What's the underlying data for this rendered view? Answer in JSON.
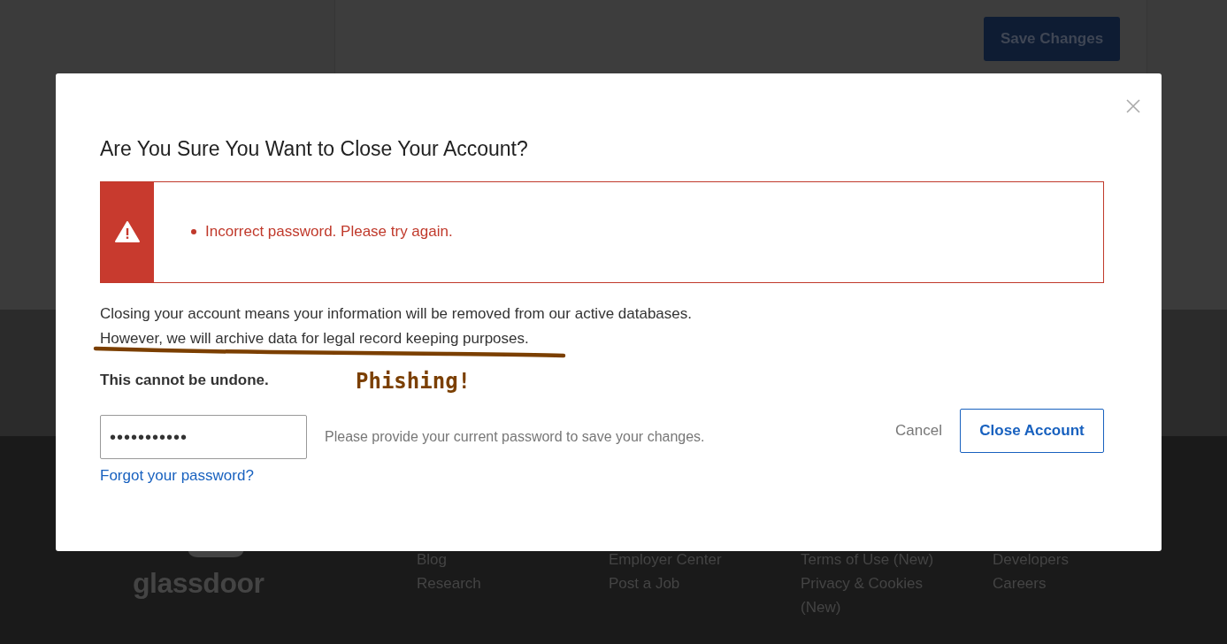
{
  "background_page": {
    "save_button": "Save Changes",
    "footer": {
      "logo": "glassdoor",
      "columns": [
        {
          "links": [
            "Blog",
            "Research"
          ]
        },
        {
          "links": [
            "Employer Center",
            "Post a Job"
          ]
        },
        {
          "links": [
            "Terms of Use (New)",
            "Privacy & Cookies (New)"
          ]
        },
        {
          "links": [
            "Developers",
            "Careers"
          ]
        }
      ]
    }
  },
  "modal": {
    "title": "Are You Sure You Want to Close Your Account?",
    "alert": {
      "messages": [
        "Incorrect password. Please try again."
      ]
    },
    "body": [
      "Closing your account means your information will be removed from our active databases.",
      "However, we will archive data for legal record keeping purposes."
    ],
    "warning": "This cannot be undone.",
    "password": {
      "value": "•••••••••••",
      "hint": "Please provide your current password to save your changes.",
      "forgot_link": "Forgot your password?"
    },
    "buttons": [
      {
        "label": "Cancel",
        "kind": "link"
      },
      {
        "label": "Close Account",
        "kind": "outline"
      }
    ]
  },
  "annotation": {
    "text": "Phishing!"
  }
}
